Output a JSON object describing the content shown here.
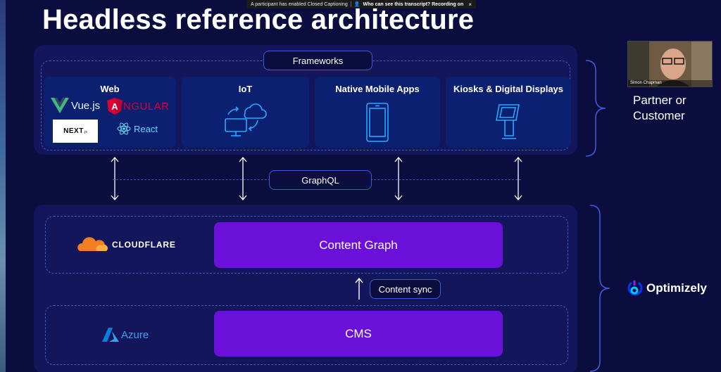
{
  "notification": {
    "caption_text": "A participant has enabled Closed Captioning",
    "question_text": "Who can see this transcript? Recording on",
    "close": "×"
  },
  "slide": {
    "title": "Headless reference architecture",
    "frameworks_label": "Frameworks",
    "graphql_label": "GraphQL",
    "content_sync_label": "Content sync",
    "cards": {
      "web": {
        "title": "Web",
        "logos": {
          "vue": "Vue.js",
          "angular": "NGULAR",
          "angular_letter": "A",
          "next": "NEXT",
          "next_suffix": ".js",
          "react": "React"
        }
      },
      "iot": {
        "title": "IoT",
        "icon": "iot-icon"
      },
      "mobile": {
        "title": "Native Mobile Apps",
        "icon": "mobile-phone-icon"
      },
      "kiosks": {
        "title": "Kiosks & Digital Displays",
        "icon": "kiosk-icon"
      }
    },
    "cloudflare": "CLOUDFLARE",
    "content_graph": "Content Graph",
    "azure": "Azure",
    "cms": "CMS",
    "partner_line1": "Partner or",
    "partner_line2": "Customer",
    "optimizely": "Optimizely"
  },
  "video": {
    "name": "Simon Chapman"
  },
  "colors": {
    "background": "#0b0d3f",
    "panel": "#14165c",
    "card": "#0b2070",
    "accent_blue": "#3e5bd6",
    "purple": "#6b10d9",
    "icon_blue": "#29a8ff",
    "cloudflare_orange": "#f38020"
  }
}
